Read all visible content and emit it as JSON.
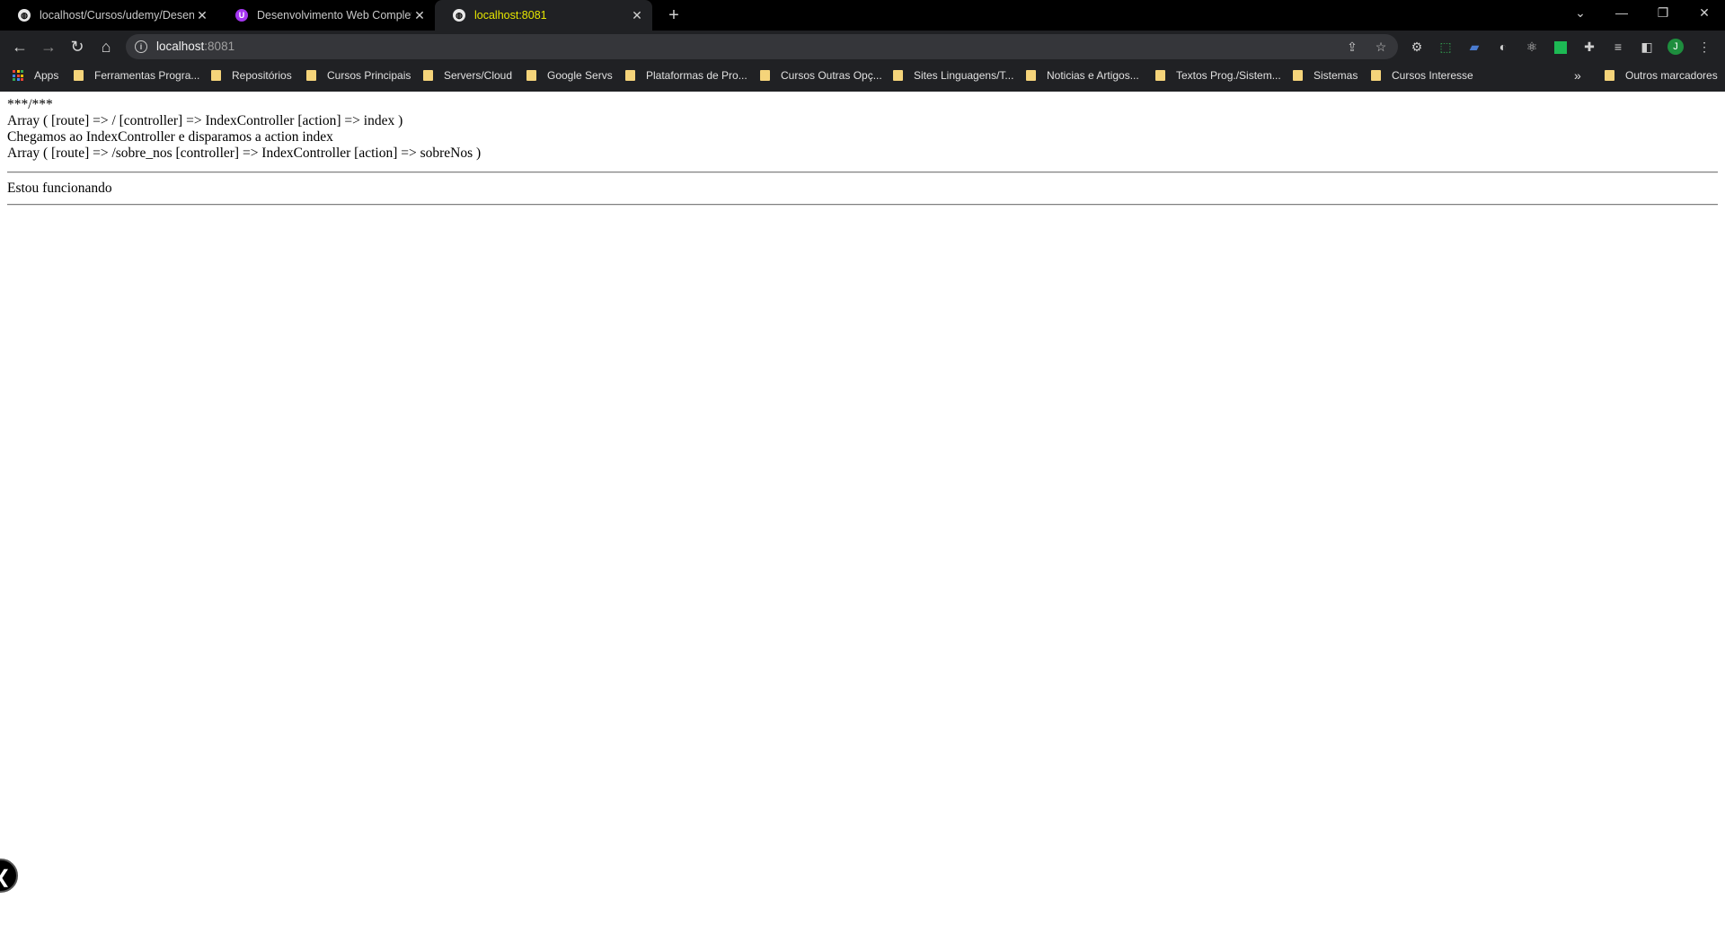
{
  "browser": {
    "tabs": [
      {
        "title": "localhost/Cursos/udemy/Desenv",
        "icon": "globe-icon",
        "active": false
      },
      {
        "title": "Desenvolvimento Web Completo",
        "icon": "udemy-icon",
        "active": false
      },
      {
        "title": "localhost:8081",
        "icon": "globe-icon",
        "active": true
      }
    ],
    "new_tab": "+",
    "address_bar": {
      "host": "localhost",
      "port": ":8081"
    },
    "bookmarks": [
      {
        "label": "Apps",
        "icon": "apps-grid-icon"
      },
      {
        "label": "Ferramentas Progra...",
        "icon": "folder-icon"
      },
      {
        "label": "Repositórios",
        "icon": "folder-icon"
      },
      {
        "label": "Cursos Principais",
        "icon": "folder-icon"
      },
      {
        "label": "Servers/Cloud",
        "icon": "folder-icon"
      },
      {
        "label": "Google Servs",
        "icon": "folder-icon"
      },
      {
        "label": "Plataformas de Pro...",
        "icon": "folder-icon"
      },
      {
        "label": "Cursos Outras Opç...",
        "icon": "folder-icon"
      },
      {
        "label": "Sites Linguagens/T...",
        "icon": "folder-icon"
      },
      {
        "label": "Noticias e Artigos...",
        "icon": "folder-icon"
      },
      {
        "label": "Textos Prog./Sistem...",
        "icon": "folder-icon"
      },
      {
        "label": "Sistemas",
        "icon": "folder-icon"
      },
      {
        "label": "Cursos Interesse",
        "icon": "folder-icon"
      }
    ],
    "bookmarks_overflow": "»",
    "other_bookmarks": "Outros marcadores",
    "profile_initial": "J",
    "colors": {
      "active_tab_text": "#e6e600",
      "chrome_bg": "#202124",
      "tabstrip_bg": "#000000",
      "folder": "#f5d47a",
      "profile": "#1e8e3e"
    }
  },
  "page": {
    "lines": [
      "***/***",
      "Array ( [route] => / [controller] => IndexController [action] => index )",
      "Chegamos ao IndexController e disparamos a action index",
      "Array ( [route] => /sobre_nos [controller] => IndexController [action] => sobreNos )"
    ],
    "content": "Estou funcionando"
  }
}
